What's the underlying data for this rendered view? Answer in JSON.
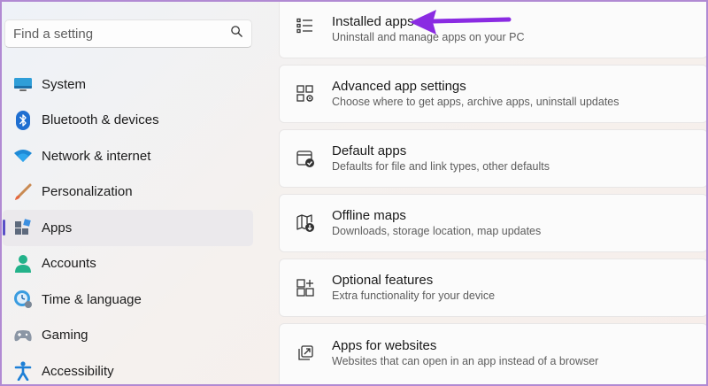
{
  "search": {
    "placeholder": "Find a setting",
    "icon": "search-icon"
  },
  "sidebar": {
    "items": [
      {
        "label": "System",
        "icon": "system-icon"
      },
      {
        "label": "Bluetooth & devices",
        "icon": "bluetooth-icon"
      },
      {
        "label": "Network & internet",
        "icon": "wifi-icon"
      },
      {
        "label": "Personalization",
        "icon": "brush-icon"
      },
      {
        "label": "Apps",
        "icon": "apps-icon",
        "active": true
      },
      {
        "label": "Accounts",
        "icon": "account-icon"
      },
      {
        "label": "Time & language",
        "icon": "clock-globe-icon"
      },
      {
        "label": "Gaming",
        "icon": "gamepad-icon"
      },
      {
        "label": "Accessibility",
        "icon": "accessibility-icon"
      }
    ]
  },
  "main": {
    "cards": [
      {
        "title": "Installed apps",
        "subtitle": "Uninstall and manage apps on your PC",
        "icon": "list-icon"
      },
      {
        "title": "Advanced app settings",
        "subtitle": "Choose where to get apps, archive apps, uninstall updates",
        "icon": "app-settings-icon"
      },
      {
        "title": "Default apps",
        "subtitle": "Defaults for file and link types, other defaults",
        "icon": "default-apps-icon"
      },
      {
        "title": "Offline maps",
        "subtitle": "Downloads, storage location, map updates",
        "icon": "map-download-icon"
      },
      {
        "title": "Optional features",
        "subtitle": "Extra functionality for your device",
        "icon": "add-features-icon"
      },
      {
        "title": "Apps for websites",
        "subtitle": "Websites that can open in an app instead of a browser",
        "icon": "open-external-icon"
      }
    ]
  },
  "colors": {
    "accent": "#5a4fc7",
    "arrow": "#8a2be2",
    "frame": "#b18ad3"
  }
}
